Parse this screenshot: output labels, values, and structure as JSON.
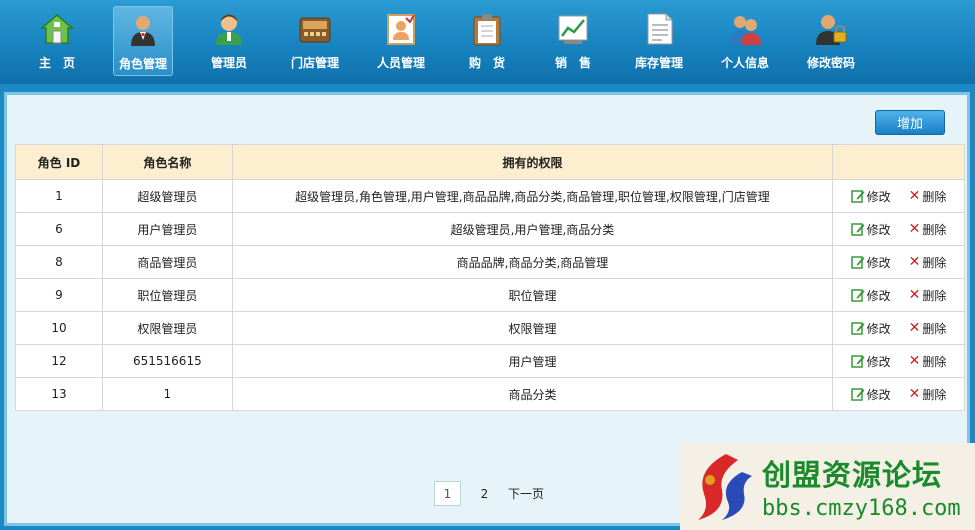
{
  "nav": [
    {
      "label": "主　页",
      "icon": "home-icon"
    },
    {
      "label": "角色管理",
      "icon": "role-icon",
      "active": true
    },
    {
      "label": "管理员",
      "icon": "admin-icon"
    },
    {
      "label": "门店管理",
      "icon": "store-icon"
    },
    {
      "label": "人员管理",
      "icon": "staff-icon"
    },
    {
      "label": "购　货",
      "icon": "purchase-icon"
    },
    {
      "label": "销　售",
      "icon": "sales-icon"
    },
    {
      "label": "库存管理",
      "icon": "inventory-icon"
    },
    {
      "label": "个人信息",
      "icon": "profile-icon"
    },
    {
      "label": "修改密码",
      "icon": "password-icon"
    }
  ],
  "toolbar": {
    "add_label": "增加"
  },
  "table": {
    "headers": [
      "角色 ID",
      "角色名称",
      "拥有的权限",
      ""
    ],
    "edit_label": "修改",
    "delete_label": "删除",
    "rows": [
      {
        "id": "1",
        "name": "超级管理员",
        "perms": "超级管理员,角色管理,用户管理,商品品牌,商品分类,商品管理,职位管理,权限管理,门店管理"
      },
      {
        "id": "6",
        "name": "用户管理员",
        "perms": "超级管理员,用户管理,商品分类"
      },
      {
        "id": "8",
        "name": "商品管理员",
        "perms": "商品品牌,商品分类,商品管理"
      },
      {
        "id": "9",
        "name": "职位管理员",
        "perms": "职位管理"
      },
      {
        "id": "10",
        "name": "权限管理员",
        "perms": "权限管理"
      },
      {
        "id": "12",
        "name": "651516615",
        "perms": "用户管理"
      },
      {
        "id": "13",
        "name": "1",
        "perms": "商品分类"
      }
    ]
  },
  "pagination": {
    "current": "1",
    "pages": [
      "2"
    ],
    "next_label": "下一页"
  },
  "watermark": {
    "title": "创盟资源论坛",
    "url": "bbs.cmzy168.com"
  }
}
